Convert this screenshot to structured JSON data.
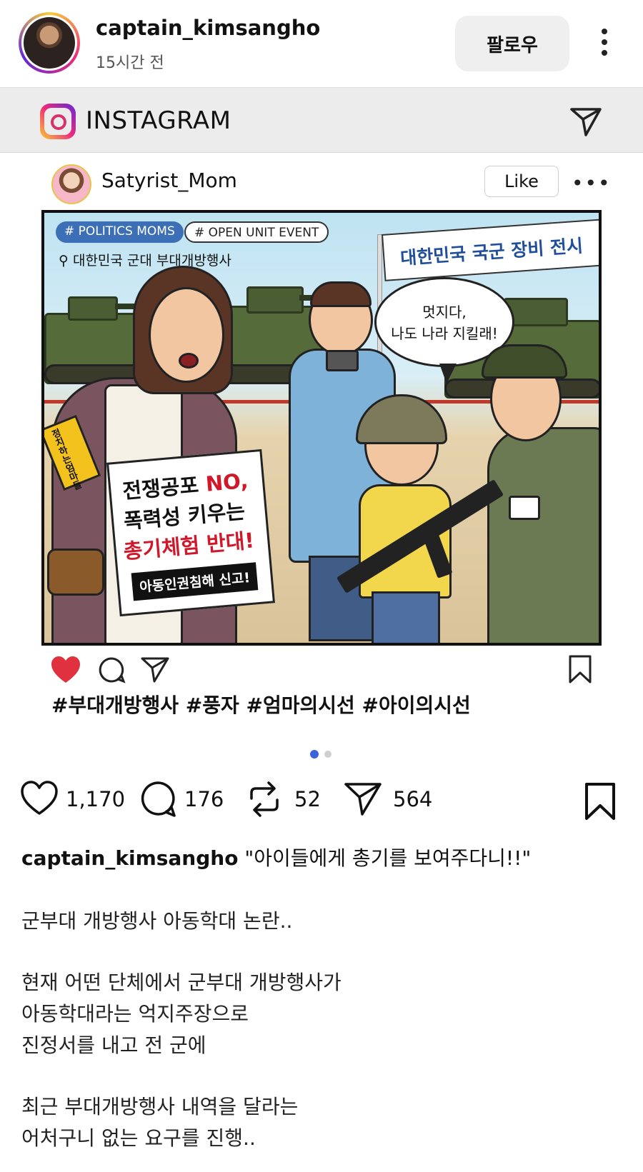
{
  "header": {
    "username": "captain_kimsangho",
    "time_ago": "15시간 전",
    "follow_label": "팔로우"
  },
  "embedded": {
    "app_title": "INSTAGRAM",
    "username": "Satyrist_Mom",
    "like_label": "Like",
    "more_label": "•••",
    "comic": {
      "tags": [
        "# POLITICS MOMS",
        "# OPEN UNIT EVENT"
      ],
      "location": "대한민국 군대 부대개방행사",
      "banner": "대한민국 국군 장비 전시",
      "bubble": [
        "멋지다,",
        "나도 나라 지킬래!"
      ],
      "armband": "정치하는엄마들",
      "sign": {
        "line1_a": "전쟁공포 ",
        "line1_b": "NO,",
        "line2": "폭력성 키우는",
        "line3": "총기체험 반대!",
        "line4": "아동인권침해 신고!"
      }
    },
    "hashtags": "#부대개방행사 #풍자 #엄마의시선 #아이의시선"
  },
  "actions": {
    "likes": "1,170",
    "comments": "176",
    "reposts": "52",
    "shares": "564"
  },
  "caption": {
    "username": "captain_kimsangho",
    "text": " \"아이들에게 총기를 보여주다니!!\"",
    "lines": [
      "군부대 개방행사 아동학대 논란..",
      "현재 어떤 단체에서 군부대 개방행사가",
      "아동학대라는 억지주장으로",
      "진정서를 내고 전 군에",
      "최근 부대개방행사 내역을 달라는",
      "어처구니 없는 요구를 진행.."
    ]
  },
  "colors": {
    "like_red": "#e0313f",
    "carousel_active": "#3a62d9",
    "sign_red": "#d0182a"
  }
}
